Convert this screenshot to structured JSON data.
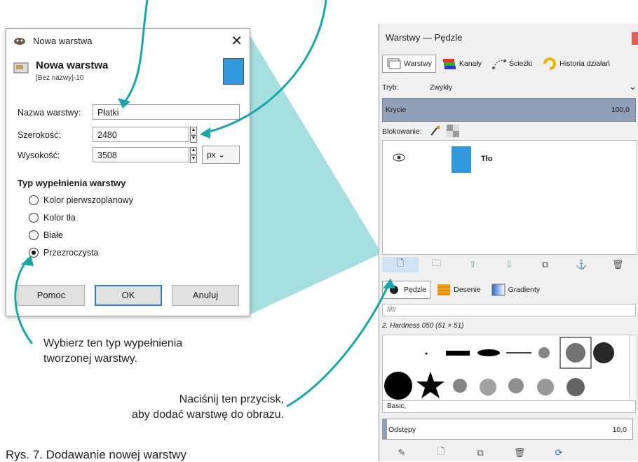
{
  "dialog": {
    "title": "Nowa warstwa",
    "header_title": "Nowa warstwa",
    "header_subtitle": "[Bez nazwy]-10",
    "swatch_color": "#3399dd",
    "name_label": "Nazwa warstwy:",
    "name_value": "Płatki",
    "width_label": "Szerokość:",
    "width_value": "2480",
    "height_label": "Wysokość:",
    "height_value": "3508",
    "unit": "px",
    "fill_section": "Typ wypełnienia warstwy",
    "fill_options": [
      "Kolor pierwszoplanowy",
      "Kolor tła",
      "Białe",
      "Przezroczysta"
    ],
    "fill_selected": "Przezroczysta",
    "buttons": {
      "help": "Pomoc",
      "ok": "OK",
      "cancel": "Anuluj"
    }
  },
  "panel": {
    "title": "Warstwy — Pędzle",
    "tabs": [
      "Warstwy",
      "Kanały",
      "Ścieżki",
      "Historia działań"
    ],
    "mode_label": "Tryb:",
    "mode_value": "Zwykły",
    "opacity_label": "Krycie",
    "opacity_value": "100,0",
    "lock_label": "Blokowanie:",
    "layer_name": "Tło",
    "layer_color": "#3399dd",
    "bottom_tabs": [
      "Pędzle",
      "Desenie",
      "Gradienty"
    ],
    "filter_placeholder": "filtr",
    "brush_name": "2. Hardness 050 (51 × 51)",
    "brush_set": "Basic,",
    "spacing_label": "Odstępy",
    "spacing_value": "10,0"
  },
  "notes": {
    "fill_note_1": "Wybierz ten typ wypełnienia",
    "fill_note_2": "tworzonej warstwy.",
    "button_note_1": "Naciśnij ten przycisk,",
    "button_note_2": "aby dodać warstwę do obrazu."
  },
  "caption": "Rys. 7. Dodawanie nowej warstwy",
  "accent_color": "#1aa6a8"
}
